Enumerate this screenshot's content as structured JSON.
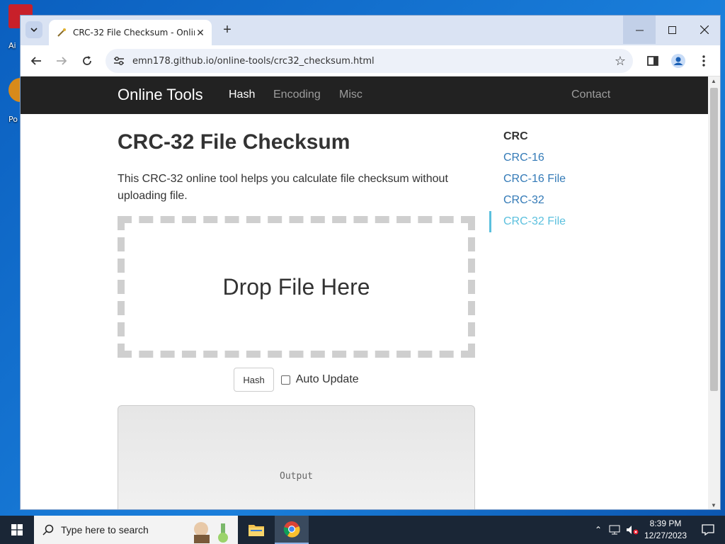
{
  "desktop": {
    "icons": [
      {
        "label": "Ai"
      },
      {
        "label": "Po"
      }
    ]
  },
  "browser": {
    "tab_title": "CRC-32 File Checksum - Online",
    "url": "emn178.github.io/online-tools/crc32_checksum.html"
  },
  "site": {
    "brand": "Online Tools",
    "nav": [
      {
        "label": "Hash",
        "active": true
      },
      {
        "label": "Encoding",
        "active": false
      },
      {
        "label": "Misc",
        "active": false
      }
    ],
    "contact": "Contact"
  },
  "main": {
    "title": "CRC-32 File Checksum",
    "description": "This CRC-32 online tool helps you calculate file checksum without uploading file.",
    "dropzone_text": "Drop File Here",
    "hash_button": "Hash",
    "auto_update_label": "Auto Update",
    "auto_update_checked": false,
    "output_placeholder": "Output"
  },
  "sidebar": {
    "header": "CRC",
    "items": [
      {
        "label": "CRC-16",
        "active": false
      },
      {
        "label": "CRC-16 File",
        "active": false
      },
      {
        "label": "CRC-32",
        "active": false
      },
      {
        "label": "CRC-32 File",
        "active": true
      }
    ]
  },
  "taskbar": {
    "search_placeholder": "Type here to search",
    "time": "8:39 PM",
    "date": "12/27/2023"
  },
  "colors": {
    "navbar_bg": "#222222",
    "link": "#337ab7",
    "active_side": "#5bc0de"
  }
}
